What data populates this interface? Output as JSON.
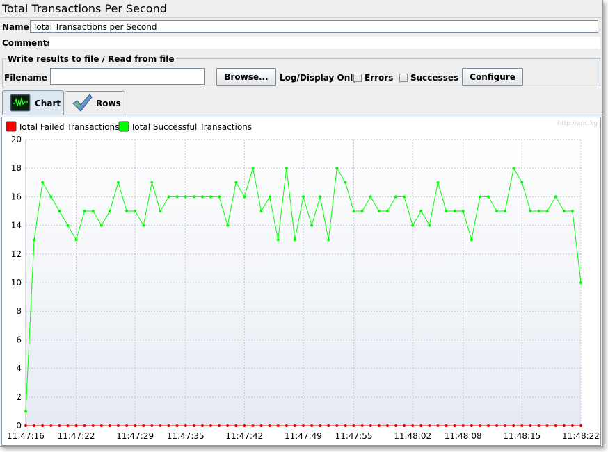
{
  "window": {
    "title": "Total Transactions Per Second"
  },
  "form": {
    "name_label": "Name:",
    "name_value": "Total Transactions per Second",
    "comments_label": "Comments:",
    "comments_value": "",
    "file_section_title": "Write results to file / Read from file",
    "filename_label": "Filename",
    "filename_value": "",
    "browse_label": "Browse...",
    "log_display_label": "Log/Display Only:",
    "errors_label": "Errors",
    "errors_checked": false,
    "successes_label": "Successes",
    "successes_checked": false,
    "configure_label": "Configure"
  },
  "tabs": [
    {
      "label": "Chart",
      "icon": "chart-icon",
      "active": true
    },
    {
      "label": "Rows",
      "icon": "checkmark-icon",
      "active": false
    }
  ],
  "watermark": "http://apc.kg",
  "colors": {
    "failed": "#ff0000",
    "successful": "#00ff00"
  },
  "chart_data": {
    "type": "line",
    "title": "",
    "xlabel": "",
    "ylabel": "",
    "ylim": [
      0,
      20
    ],
    "yticks": [
      0,
      2,
      4,
      6,
      8,
      10,
      12,
      14,
      16,
      18,
      20
    ],
    "xlim": [
      "11:47:16",
      "11:48:22"
    ],
    "xtick_labels": [
      "11:47:16",
      "11:47:22",
      "11:47:29",
      "11:47:35",
      "11:47:42",
      "11:47:49",
      "11:47:55",
      "11:48:02",
      "11:48:08",
      "11:48:15",
      "11:48:22"
    ],
    "grid": true,
    "legend": "top-left",
    "x": [
      "11:47:16",
      "11:47:17",
      "11:47:18",
      "11:47:19",
      "11:47:20",
      "11:47:21",
      "11:47:22",
      "11:47:23",
      "11:47:24",
      "11:47:25",
      "11:47:26",
      "11:47:27",
      "11:47:28",
      "11:47:29",
      "11:47:30",
      "11:47:31",
      "11:47:32",
      "11:47:33",
      "11:47:34",
      "11:47:35",
      "11:47:36",
      "11:47:37",
      "11:47:38",
      "11:47:39",
      "11:47:40",
      "11:47:41",
      "11:47:42",
      "11:47:43",
      "11:47:44",
      "11:47:45",
      "11:47:46",
      "11:47:47",
      "11:47:48",
      "11:47:49",
      "11:47:50",
      "11:47:51",
      "11:47:52",
      "11:47:53",
      "11:47:54",
      "11:47:55",
      "11:47:56",
      "11:47:57",
      "11:47:58",
      "11:47:59",
      "11:48:00",
      "11:48:01",
      "11:48:02",
      "11:48:03",
      "11:48:04",
      "11:48:05",
      "11:48:06",
      "11:48:07",
      "11:48:08",
      "11:48:09",
      "11:48:10",
      "11:48:11",
      "11:48:12",
      "11:48:13",
      "11:48:14",
      "11:48:15",
      "11:48:16",
      "11:48:17",
      "11:48:18",
      "11:48:19",
      "11:48:20",
      "11:48:21",
      "11:48:22"
    ],
    "series": [
      {
        "name": "Total Failed Transactions",
        "color": "#ff0000",
        "values": [
          0,
          0,
          0,
          0,
          0,
          0,
          0,
          0,
          0,
          0,
          0,
          0,
          0,
          0,
          0,
          0,
          0,
          0,
          0,
          0,
          0,
          0,
          0,
          0,
          0,
          0,
          0,
          0,
          0,
          0,
          0,
          0,
          0,
          0,
          0,
          0,
          0,
          0,
          0,
          0,
          0,
          0,
          0,
          0,
          0,
          0,
          0,
          0,
          0,
          0,
          0,
          0,
          0,
          0,
          0,
          0,
          0,
          0,
          0,
          0,
          0,
          0,
          0,
          0,
          0,
          0,
          0
        ]
      },
      {
        "name": "Total Successful Transactions",
        "color": "#00ff00",
        "values": [
          1,
          13,
          17,
          16,
          15,
          14,
          13,
          15,
          15,
          14,
          15,
          17,
          15,
          15,
          14,
          17,
          15,
          16,
          16,
          16,
          16,
          16,
          16,
          16,
          14,
          17,
          16,
          18,
          15,
          16,
          13,
          18,
          13,
          16,
          14,
          16,
          13,
          18,
          17,
          15,
          15,
          16,
          15,
          15,
          16,
          16,
          14,
          15,
          14,
          17,
          15,
          15,
          15,
          13,
          16,
          16,
          15,
          15,
          18,
          17,
          15,
          15,
          15,
          16,
          15,
          15,
          10
        ]
      }
    ]
  }
}
